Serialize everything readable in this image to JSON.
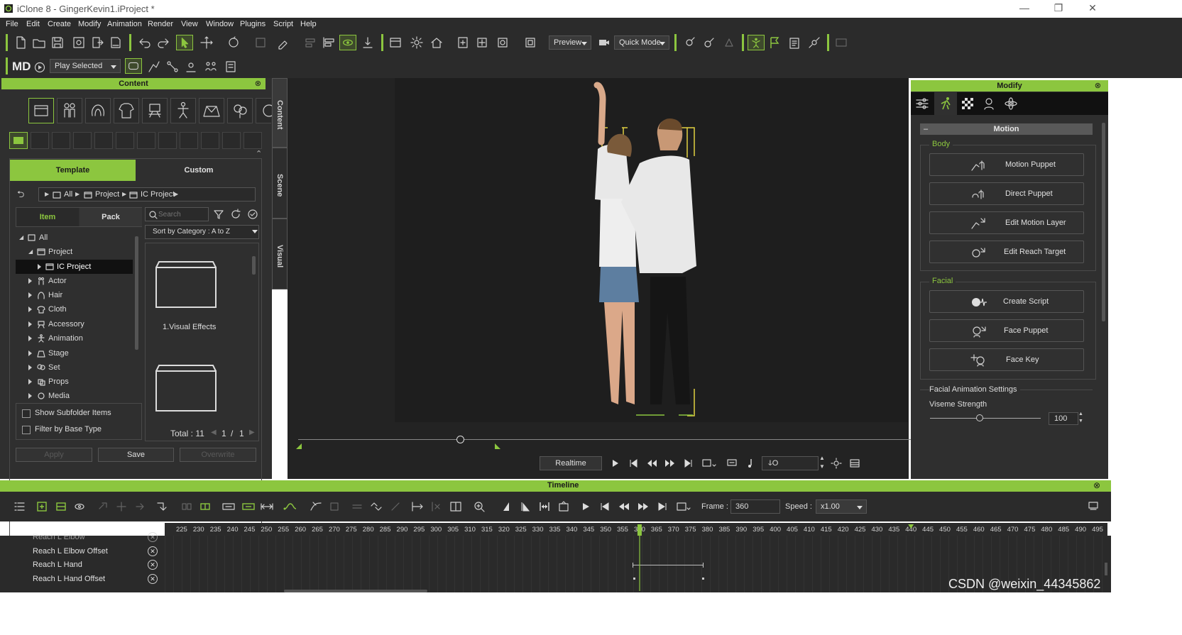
{
  "window": {
    "title": "iClone 8 - GingerKevin1.iProject *",
    "minimize": "—",
    "restore": "❐",
    "close": "✕"
  },
  "menu": [
    "File",
    "Edit",
    "Create",
    "Modify",
    "Animation",
    "Render",
    "View",
    "Window",
    "Plugins",
    "Script",
    "Help"
  ],
  "toolbar": {
    "preview_label": "Preview",
    "quick_mode_label": "Quick Mode",
    "play_selected_label": "Play Selected"
  },
  "content_panel": {
    "title": "Content",
    "tabs": {
      "template": "Template",
      "custom": "Custom"
    },
    "breadcrumb": [
      "All",
      "Project",
      "IC Project"
    ],
    "subtabs": {
      "item": "Item",
      "pack": "Pack"
    },
    "search_placeholder": "Search",
    "sort_label": "Sort by Category : A to Z",
    "tree": [
      "All",
      "Project",
      "IC Project",
      "Actor",
      "Hair",
      "Cloth",
      "Accessory",
      "Animation",
      "Stage",
      "Set",
      "Props",
      "Media"
    ],
    "thumbnails": [
      "1.Visual Effects"
    ],
    "show_subfolder": "Show Subfolder Items",
    "filter_base": "Filter by Base Type",
    "total_label": "Total : 11",
    "page": "1",
    "page_sep": "/",
    "page_total": "1",
    "buttons": {
      "apply": "Apply",
      "save": "Save",
      "overwrite": "Overwrite"
    }
  },
  "side_tabs": [
    "Content",
    "Scene",
    "Visual"
  ],
  "modify_panel": {
    "title": "Modify",
    "section": "Motion",
    "body_label": "Body",
    "body_buttons": [
      "Motion Puppet",
      "Direct Puppet",
      "Edit Motion Layer",
      "Edit Reach Target"
    ],
    "facial_label": "Facial",
    "facial_buttons": [
      "Create Script",
      "Face Puppet",
      "Face Key"
    ],
    "facial_settings": "Facial Animation Settings",
    "viseme_label": "Viseme Strength",
    "viseme_value": "100",
    "viseme_level": 0.45
  },
  "playback": {
    "realtime_label": "Realtime",
    "frame_field": "ↆO"
  },
  "timeline": {
    "title": "Timeline",
    "frame_label": "Frame :",
    "frame_value": "360",
    "speed_label": "Speed :",
    "speed_value": "x1.00",
    "ruler_start": 220,
    "ruler_step": 5,
    "ruler_end": 495,
    "ruler_labels": [
      "225",
      "230",
      "235",
      "240",
      "245",
      "250",
      "255",
      "260",
      "265",
      "270",
      "275",
      "280",
      "285",
      "290",
      "295",
      "300",
      "305",
      "310",
      "315",
      "320",
      "325",
      "330",
      "335",
      "340",
      "345",
      "350",
      "355",
      "360",
      "365",
      "370",
      "375",
      "380",
      "385",
      "390",
      "395",
      "400",
      "405",
      "410",
      "415",
      "420",
      "425",
      "430",
      "435",
      "440",
      "445",
      "450",
      "455",
      "460",
      "465",
      "470",
      "475",
      "480",
      "485",
      "490",
      "495"
    ],
    "current_frame": 360,
    "tracks": [
      "Reach L Elbow",
      "Reach L Elbow Offset",
      "Reach L Hand",
      "Reach L Hand Offset"
    ]
  },
  "watermark": "CSDN @weixin_44345862",
  "colors": {
    "accent": "#8cc63f",
    "panel": "#2f2f2f",
    "background": "#232323"
  }
}
